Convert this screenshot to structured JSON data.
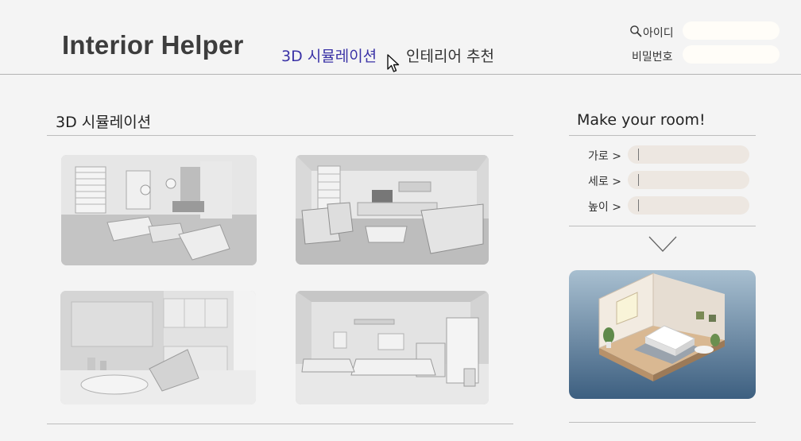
{
  "header": {
    "logo": "Interior Helper",
    "nav": [
      {
        "label": "3D 시뮬레이션",
        "active": true
      },
      {
        "label": "인테리어 추천",
        "active": false
      }
    ]
  },
  "login": {
    "id_label": "아이디",
    "password_label": "비밀번호"
  },
  "simulation": {
    "title": "3D 시뮬레이션",
    "thumbnails": [
      {
        "icon": "living-room-render-1"
      },
      {
        "icon": "living-room-render-2"
      },
      {
        "icon": "kitchen-living-render"
      },
      {
        "icon": "bedroom-render"
      }
    ]
  },
  "make_room": {
    "title": "Make your room!",
    "fields": [
      {
        "label": "가로 >"
      },
      {
        "label": "세로 >"
      },
      {
        "label": "높이 >"
      }
    ],
    "preview_icon": "isometric-room-preview"
  },
  "colors": {
    "accent": "#3a32a6",
    "background": "#f4f4f4",
    "input_bg": "#ede7e1",
    "login_input_bg": "#fffdf8"
  }
}
